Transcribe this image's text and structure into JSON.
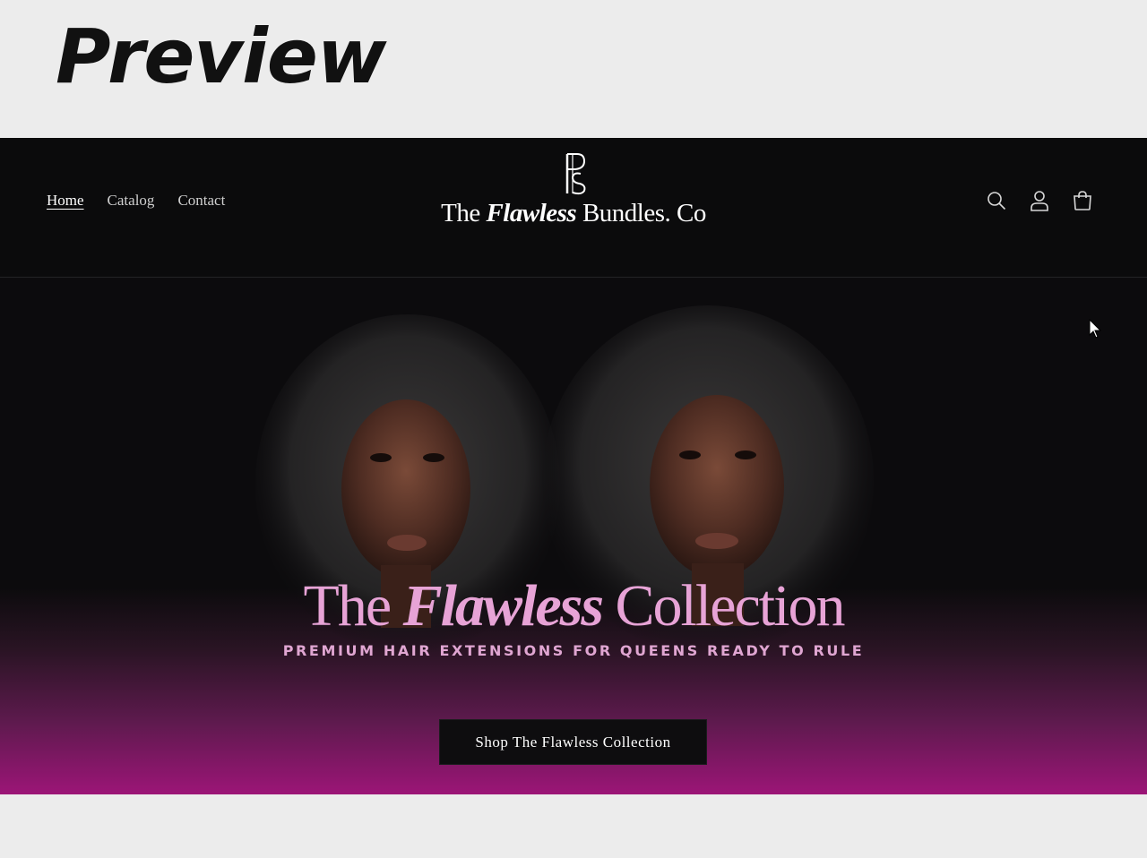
{
  "banner": {
    "label": "Preview"
  },
  "nav": {
    "items": [
      {
        "label": "Home",
        "active": true
      },
      {
        "label": "Catalog",
        "active": false
      },
      {
        "label": "Contact",
        "active": false
      }
    ]
  },
  "logo": {
    "monogram": "BF",
    "prefix": "The",
    "emphasis": "Flawless",
    "suffix": "Bundles. Co"
  },
  "header_icons": [
    "search-icon",
    "account-icon",
    "cart-icon"
  ],
  "hero": {
    "title_prefix": "The",
    "title_emphasis": "Flawless",
    "title_suffix": "Collection",
    "subtitle": "PREMIUM HAIR EXTENSIONS FOR QUEENS READY TO RULE",
    "cta_label": "Shop The Flawless Collection"
  },
  "colors": {
    "header_bg": "#0b0b0c",
    "accent_pink": "#e7a3d6",
    "gradient_magenta": "#9c1577"
  }
}
